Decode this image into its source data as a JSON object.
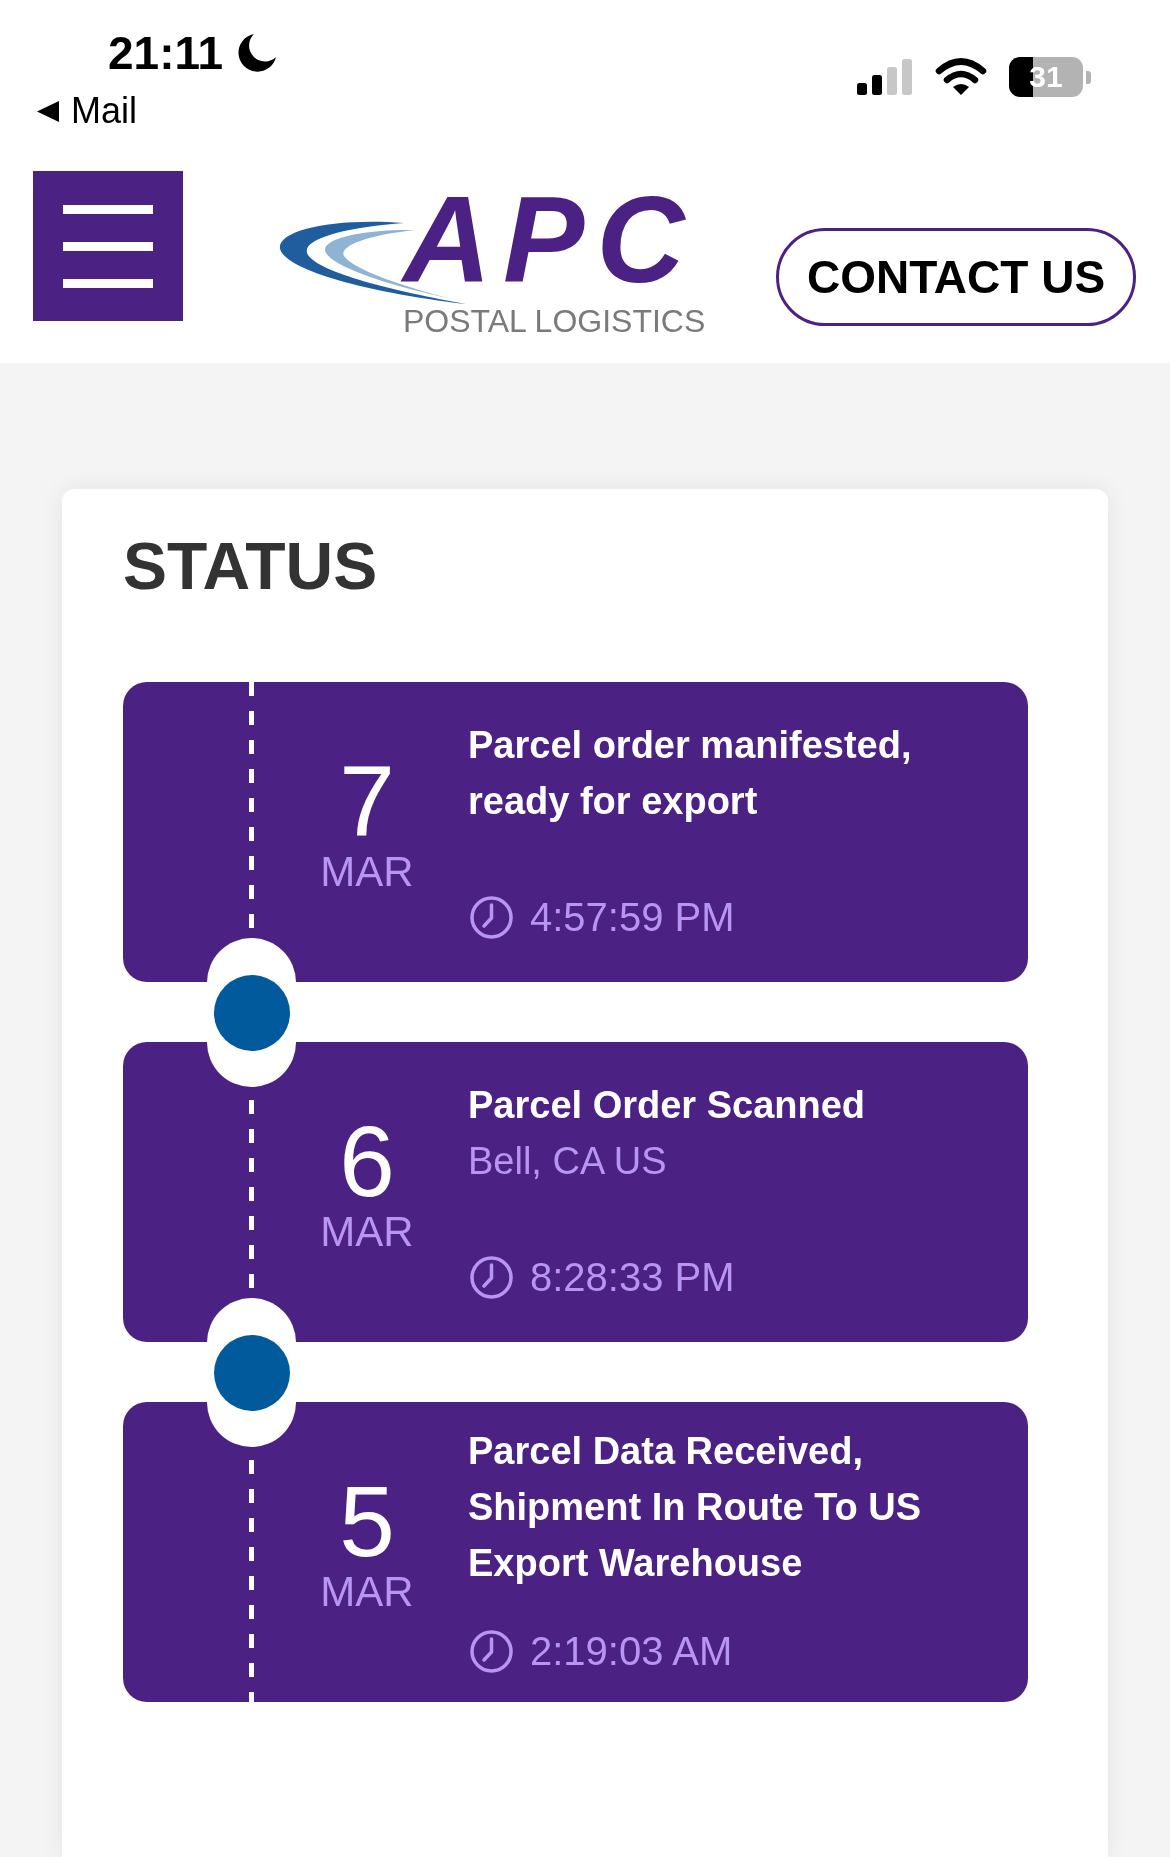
{
  "status_bar": {
    "time": "21:11",
    "back_link": "Mail",
    "battery": "31"
  },
  "header": {
    "logo": {
      "wordmark": "APC",
      "tagline": "POSTAL LOGISTICS"
    },
    "contact_button": "CONTACT US"
  },
  "status": {
    "title": "STATUS",
    "events": [
      {
        "day": "7",
        "month": "MAR",
        "title": "Parcel order manifested, ready for export",
        "time": "4:57:59 PM"
      },
      {
        "day": "6",
        "month": "MAR",
        "title": "Parcel Order Scanned",
        "location": "Bell, CA US",
        "time": "8:28:33 PM"
      },
      {
        "day": "5",
        "month": "MAR",
        "title": "Parcel Data Received, Shipment In Route To US Export Warehouse",
        "time": "2:19:03 AM"
      }
    ]
  }
}
